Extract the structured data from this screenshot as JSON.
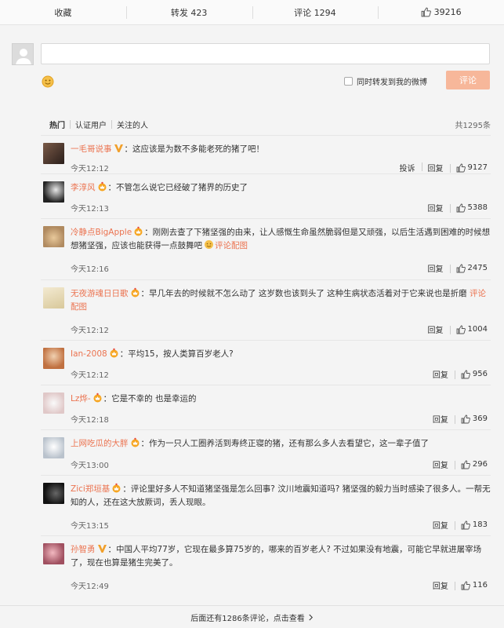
{
  "action_bar": {
    "favorite_label": "收藏",
    "repost_label": "转发 423",
    "comment_label": "评论 1294",
    "like_count": "39216"
  },
  "compose": {
    "repost_checkbox_label": "同时转发到我的微博",
    "submit_label": "评论"
  },
  "filters": {
    "tabs": [
      "热门",
      "认证用户",
      "关注的人"
    ],
    "total": "共1295条"
  },
  "comments": [
    {
      "user": "一毛哥说事",
      "badge": "v",
      "text": "：这应该是为数不多能老死的猪了吧！",
      "link": "",
      "time": "今天12:12",
      "report": "投诉",
      "reply": "回复",
      "likes": "9127"
    },
    {
      "user": "李淳风",
      "badge": "crown",
      "text": "：不管怎么说它已经破了猪界的历史了",
      "link": "",
      "time": "今天12:13",
      "report": "",
      "reply": "回复",
      "likes": "5388"
    },
    {
      "user": "冷静点BigApple",
      "badge": "crown",
      "text": "：刚刚去查了下猪坚强的由来，让人感慨生命虽然脆弱但是又顽强，以后生活遇到困难的时候想想猪坚强，应该也能获得一点鼓舞吧",
      "link": "评论配图",
      "time": "今天12:16",
      "report": "",
      "reply": "回复",
      "likes": "2475"
    },
    {
      "user": "无夜游魂日日歌",
      "badge": "crown",
      "text": "：早几年去的时候就不怎么动了 这岁数也该到头了 这种生病状态活着对于它来说也是折磨",
      "link": "评论配图",
      "time": "今天12:12",
      "report": "",
      "reply": "回复",
      "likes": "1004"
    },
    {
      "user": "Ian-2008",
      "badge": "crown",
      "text": "：平均15，按人类算百岁老人?",
      "link": "",
      "time": "今天12:12",
      "report": "",
      "reply": "回复",
      "likes": "956"
    },
    {
      "user": "Lz烨-",
      "badge": "crown",
      "text": "：它是不幸的 也是幸运的",
      "link": "",
      "time": "今天12:18",
      "report": "",
      "reply": "回复",
      "likes": "369"
    },
    {
      "user": "上网吃瓜的大胖",
      "badge": "crown",
      "text": "：作为一只人工圈养活到寿终正寝的猪，还有那么多人去看望它，这一辈子值了",
      "link": "",
      "time": "今天13:00",
      "report": "",
      "reply": "回复",
      "likes": "296"
    },
    {
      "user": "Zici郑垣基",
      "badge": "crown",
      "text": "：评论里好多人不知道猪坚强是怎么回事? 汶川地震知道吗? 猪坚强的毅力当时感染了很多人。一帮无知的人，还在这大放厥词，丢人现眼。",
      "link": "",
      "time": "今天13:15",
      "report": "",
      "reply": "回复",
      "likes": "183"
    },
    {
      "user": "孙智勇",
      "badge": "v",
      "text": "：中国人平均77岁，它现在最多算75岁的，哪来的百岁老人? 不过如果没有地震，可能它早就进屠宰场了，现在也算是猪生完美了。",
      "link": "",
      "time": "今天12:49",
      "report": "",
      "reply": "回复",
      "likes": "116"
    }
  ],
  "more_text": "后面还有1286条评论，点击查看",
  "colors": {
    "accent": "#eb7350",
    "submit": "#f7b79a"
  }
}
